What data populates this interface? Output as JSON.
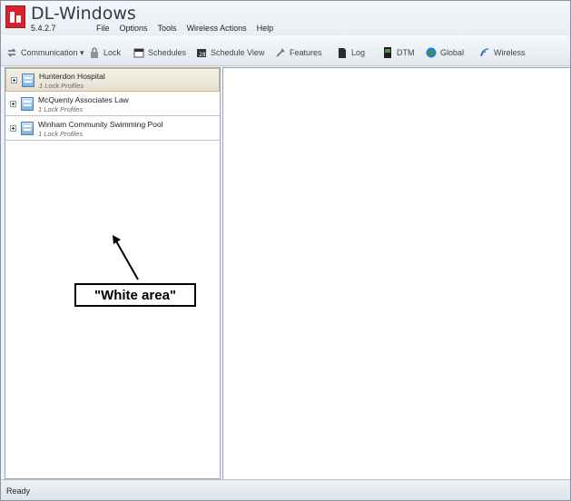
{
  "app": {
    "title": "DL-Windows",
    "version": "5.4.2.7"
  },
  "menu": [
    "File",
    "Options",
    "Tools",
    "Wireless Actions",
    "Help"
  ],
  "toolbar": [
    {
      "label": "Communication ▾",
      "icon": "communication-icon"
    },
    {
      "label": "Lock",
      "icon": "lock-icon"
    },
    {
      "label": "Schedules",
      "icon": "calendar-icon"
    },
    {
      "label": "Schedule View",
      "icon": "schedule-view-icon"
    },
    {
      "label": "Features",
      "icon": "features-icon"
    },
    {
      "label": "Log",
      "icon": "log-icon"
    },
    {
      "label": "DTM",
      "icon": "dtm-icon"
    },
    {
      "label": "Global",
      "icon": "globe-icon"
    },
    {
      "label": "Wireless",
      "icon": "wireless-icon"
    }
  ],
  "sites": [
    {
      "name": "Hunterdon Hospital",
      "sub": "1 Lock Profiles",
      "selected": true
    },
    {
      "name": "McQuenty Associates Law",
      "sub": "1 Lock Profiles",
      "selected": false
    },
    {
      "name": "Winham Community Swimming Pool",
      "sub": "1 Lock Profiles",
      "selected": false
    }
  ],
  "annotation": {
    "label": "\"White area\""
  },
  "status": {
    "text": "Ready"
  },
  "colors": {
    "logo": "#d8232a",
    "selection": "#e6e0cf",
    "global": "#3a9a2e"
  }
}
